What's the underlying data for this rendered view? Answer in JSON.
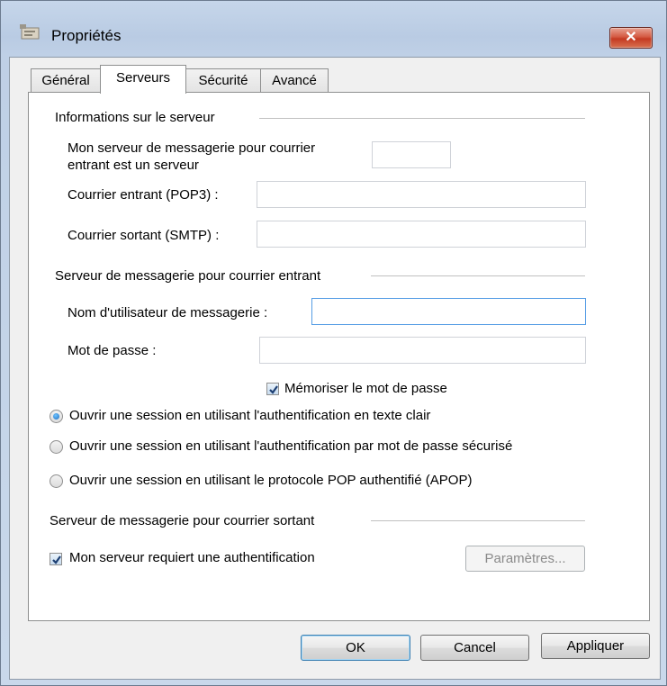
{
  "window": {
    "title": "Propriétés",
    "close_label": "✕"
  },
  "tabs": [
    {
      "label": "Général"
    },
    {
      "label": "Serveurs"
    },
    {
      "label": "Sécurité"
    },
    {
      "label": "Avancé"
    }
  ],
  "server_info": {
    "heading": "Informations sur le serveur",
    "incoming_type_label_1": "Mon serveur de messagerie pour courrier",
    "incoming_type_label_2": "entrant est un serveur",
    "incoming_type_value": "",
    "incoming_label": "Courrier entrant (POP3) :",
    "incoming_value": "",
    "outgoing_label": "Courrier sortant (SMTP) :",
    "outgoing_value": ""
  },
  "incoming_server": {
    "heading": "Serveur de messagerie pour courrier entrant",
    "username_label": "Nom d'utilisateur de messagerie :",
    "username_value": "",
    "password_label": "Mot de passe :",
    "password_value": "",
    "remember_label": "Mémoriser le mot de passe",
    "remember_checked": true
  },
  "auth_options": [
    {
      "label": "Ouvrir une session en utilisant l'authentification en texte clair",
      "selected": true
    },
    {
      "label": "Ouvrir une session en utilisant l'authentification par mot de passe sécurisé",
      "selected": false
    },
    {
      "label": "Ouvrir une session en utilisant le protocole POP authentifié (APOP)",
      "selected": false
    }
  ],
  "outgoing_server": {
    "heading": "Serveur de messagerie pour courrier sortant",
    "requires_auth_label": "Mon serveur requiert une authentification",
    "requires_auth_checked": true,
    "settings_button": "Paramètres..."
  },
  "buttons": {
    "ok": "OK",
    "cancel": "Cancel",
    "apply": "Appliquer"
  }
}
